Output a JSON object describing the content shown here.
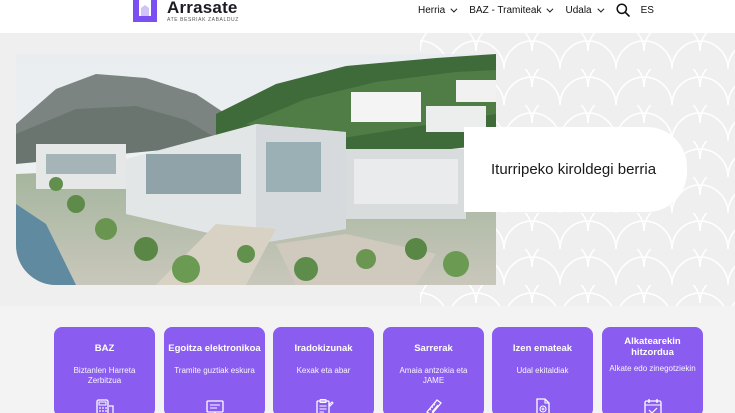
{
  "logo": {
    "title": "Arrasate",
    "subtitle": "ATE BESRIAK ZABALDUZ",
    "color": "#7b4ff2"
  },
  "nav": {
    "items": [
      {
        "label": "Herria"
      },
      {
        "label": "BAZ - Tramiteak"
      },
      {
        "label": "Udala"
      }
    ],
    "search_icon": "search-icon",
    "lang_label": "ES"
  },
  "hero": {
    "title": "Iturripeko kiroldegi berria"
  },
  "cards": [
    {
      "title": "BAZ",
      "desc": "Biztanlen Harreta Zerbitzua",
      "icon": "calculator-icon"
    },
    {
      "title": "Egoitza elektronikoa",
      "desc": "Tramite guztiak eskura",
      "icon": "computer-icon"
    },
    {
      "title": "Iradokizunak",
      "desc": "Kexak eta abar",
      "icon": "clipboard-icon"
    },
    {
      "title": "Sarrerak",
      "desc": "Amaia antzokia eta JAME",
      "icon": "ticket-icon"
    },
    {
      "title": "Izen emateak",
      "desc": "Udal ekitaldiak",
      "icon": "document-icon"
    },
    {
      "title": "Alkatearekin hitzordua",
      "desc": "Alkate edo zinegotziekin",
      "icon": "calendar-icon"
    }
  ],
  "colors": {
    "accent": "#8a5cf0",
    "hero_bg": "#efefef"
  }
}
